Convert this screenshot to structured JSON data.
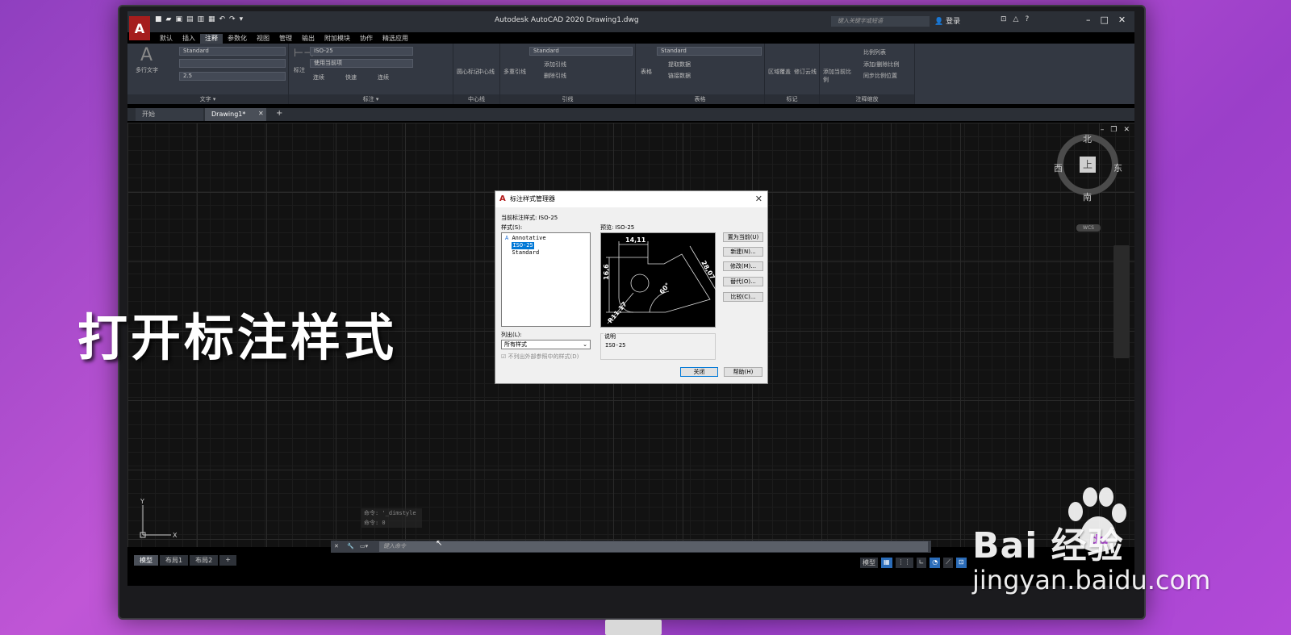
{
  "app": {
    "logo": "A",
    "window_title": "Autodesk AutoCAD 2020    Drawing1.dwg",
    "search_placeholder": "键入关键字或短语",
    "user_label": "登录"
  },
  "ribbon_tabs": [
    "默认",
    "插入",
    "注释",
    "参数化",
    "视图",
    "管理",
    "输出",
    "附加模块",
    "协作",
    "精选应用"
  ],
  "ribbon_active_tab": "注释",
  "ribbon": {
    "text_panel": {
      "title": "文字 ▾",
      "big_button": "多行文字",
      "style_value": "Standard",
      "height_value": "2.5"
    },
    "dim_panel": {
      "title": "标注 ▾",
      "big_button": "标注",
      "style_value": "ISO-25",
      "layer_value": "使用当前项",
      "tools": [
        "连续",
        "快速",
        "连续"
      ]
    },
    "centerline_panel": {
      "title": "中心线",
      "items": [
        "圆心标记",
        "中心线"
      ]
    },
    "leader_panel": {
      "title": "引线",
      "big_button": "多重引线",
      "style_value": "Standard",
      "tools": [
        "添加引线",
        "删除引线"
      ]
    },
    "table_panel": {
      "title": "表格",
      "big_button": "表格",
      "style_value": "Standard",
      "tools": [
        "提取数据",
        "链接数据"
      ]
    },
    "markup_panel": {
      "title": "标记",
      "items": [
        "区域覆盖",
        "修订云线"
      ]
    },
    "scale_panel": {
      "title": "注释缩放",
      "big_button": "添加当前比例",
      "tools": [
        "比例列表",
        "添加/删除比例",
        "同步比例位置"
      ]
    }
  },
  "doc_tabs": [
    "开始",
    "Drawing1*"
  ],
  "viewcube": {
    "north": "北",
    "south": "南",
    "east": "东",
    "west": "西",
    "top": "上",
    "wcs": "WCS"
  },
  "command_history": [
    "命令: '_dimstyle",
    "命令: 0"
  ],
  "command_placeholder": "键入命令",
  "layout_tabs": [
    "模型",
    "布局1",
    "布局2"
  ],
  "status_bar": {
    "model": "模型"
  },
  "dialog": {
    "title": "标注样式管理器",
    "current_style_label": "当前标注样式: ISO-25",
    "styles_label": "样式(S):",
    "styles": [
      "Annotative",
      "ISO-25",
      "Standard"
    ],
    "selected_style": "ISO-25",
    "preview_label": "预览: ISO-25",
    "list_label": "列出(L):",
    "list_value": "所有样式",
    "xref_checkbox": "不列出外部参照中的样式(D)",
    "desc_label": "说明",
    "desc_value": "ISO-25",
    "buttons": {
      "set_current": "置为当前(U)",
      "new": "新建(N)...",
      "modify": "修改(M)...",
      "override": "替代(O)...",
      "compare": "比较(C)...",
      "close": "关闭",
      "help": "帮助(H)"
    },
    "preview_dims": {
      "top": "14,11",
      "left": "16,6",
      "right": "28,07",
      "angle": "60°",
      "radius": "R11,17"
    }
  },
  "overlay_text": "打开标注样式",
  "watermark": {
    "logo_text": "Bai  经验",
    "url": "jingyan.baidu.com"
  },
  "colors": {
    "accent": "#0078d7",
    "logo_red": "#a51d1d",
    "background_purple": "#b04ad4"
  }
}
